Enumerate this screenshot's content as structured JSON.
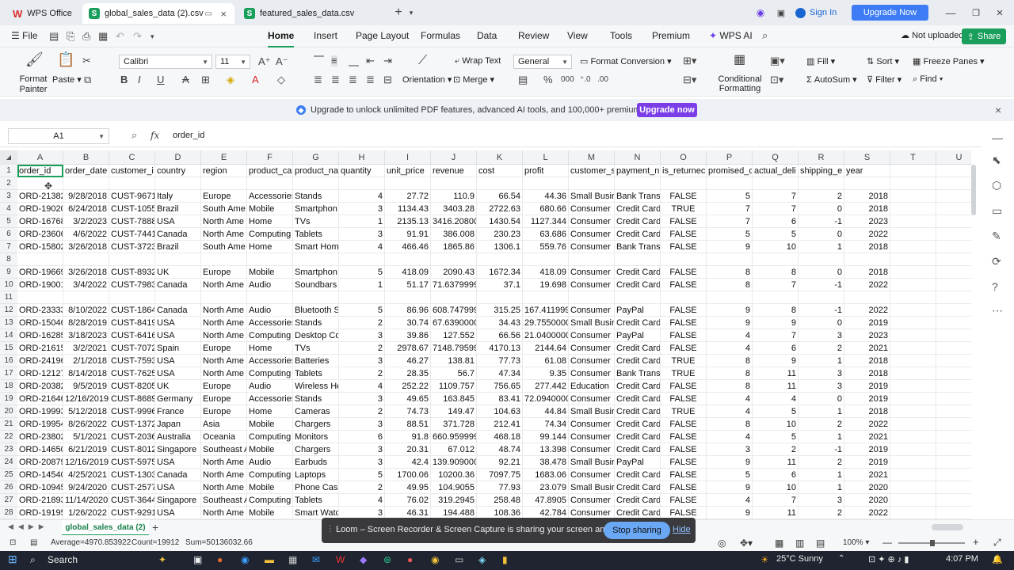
{
  "titlebar": {
    "app_tab": "WPS Office",
    "tabs": [
      {
        "label": "global_sales_data (2).csv"
      },
      {
        "label": "featured_sales_data.csv"
      }
    ],
    "sign_in": "Sign In",
    "upgrade": "Upgrade Now"
  },
  "menubar": {
    "file": "File",
    "items": [
      "Home",
      "Insert",
      "Page Layout",
      "Formulas",
      "Data",
      "Review",
      "View",
      "Tools",
      "Premium",
      "WPS AI"
    ],
    "not_uploaded": "Not uploaded",
    "share": "Share"
  },
  "ribbon": {
    "format_painter": "Format Painter",
    "paste": "Paste",
    "font": "Calibri",
    "font_size": "11",
    "wrap_text": "Wrap Text",
    "orientation": "Orientation",
    "merge": "Merge",
    "number_format": "General",
    "format_conversion": "Format Conversion",
    "conditional_formatting": "Conditional Formatting",
    "fill": "Fill",
    "sort": "Sort",
    "freeze_panes": "Freeze Panes",
    "autosum": "AutoSum",
    "filter": "Filter",
    "find": "Find"
  },
  "promo": {
    "text": "Upgrade to unlock unlimited PDF features, advanced AI tools, and 100,000+ premium templates.",
    "button": "Upgrade now"
  },
  "formula_bar": {
    "name_box": "A1",
    "fx": "fx",
    "formula": "order_id"
  },
  "sheet": {
    "columns": [
      "A",
      "B",
      "C",
      "D",
      "E",
      "F",
      "G",
      "H",
      "I",
      "J",
      "K",
      "L",
      "M",
      "N",
      "O",
      "P",
      "Q",
      "R",
      "S",
      "T",
      "U"
    ],
    "headers": [
      "order_id",
      "order_date",
      "customer_i",
      "country",
      "region",
      "product_ca",
      "product_na",
      "quantity",
      "unit_price",
      "revenue",
      "cost",
      "profit",
      "customer_s",
      "payment_n",
      "is_returnec",
      "promised_c",
      "actual_deli",
      "shipping_e",
      "year"
    ],
    "rows": [
      {
        "n": "1",
        "header": true
      },
      {
        "n": "2",
        "cells": []
      },
      {
        "n": "3",
        "cells": [
          "ORD-21382!",
          "9/28/2018",
          "CUST-96711",
          "Italy",
          "Europe",
          "Accessories",
          "Stands",
          "4",
          "27.72",
          "110.9",
          "66.54",
          "44.36",
          "Small Busir",
          "Bank Transf",
          "FALSE",
          "5",
          "7",
          "2",
          "2018"
        ]
      },
      {
        "n": "4",
        "cells": [
          "ORD-19020:",
          "6/24/2018",
          "CUST-10553",
          "Brazil",
          "South Ame",
          "Mobile",
          "Smartphon",
          "3",
          "1134.43",
          "3403.28",
          "2722.63",
          "680.66",
          "Consumer",
          "Credit Card",
          "TRUE",
          "7",
          "7",
          "0",
          "2018"
        ]
      },
      {
        "n": "5",
        "cells": [
          "ORD-16768(",
          "3/2/2023",
          "CUST-78887",
          "USA",
          "North Ame",
          "Home",
          "TVs",
          "1",
          "2135.13",
          "3416.20800(",
          "1430.54",
          "1127.344",
          "Consumer",
          "Credit Card",
          "FALSE",
          "7",
          "6",
          "-1",
          "2023"
        ]
      },
      {
        "n": "6",
        "cells": [
          "ORD-23606!",
          "4/6/2022",
          "CUST-74416",
          "Canada",
          "North Ame",
          "Computing",
          "Tablets",
          "3",
          "91.91",
          "386.008",
          "230.23",
          "63.686",
          "Consumer",
          "Credit Card",
          "FALSE",
          "5",
          "5",
          "0",
          "2022"
        ]
      },
      {
        "n": "7",
        "cells": [
          "ORD-15802",
          "3/26/2018",
          "CUST-37230",
          "Brazil",
          "South Ame",
          "Home",
          "Smart Hom",
          "4",
          "466.46",
          "1865.86",
          "1306.1",
          "559.76",
          "Consumer",
          "Bank Transf",
          "FALSE",
          "9",
          "10",
          "1",
          "2018"
        ]
      },
      {
        "n": "8",
        "cells": []
      },
      {
        "n": "9",
        "cells": [
          "ORD-19669",
          "3/26/2018",
          "CUST-89326",
          "UK",
          "Europe",
          "Mobile",
          "Smartphon",
          "5",
          "418.09",
          "2090.43",
          "1672.34",
          "418.09",
          "Consumer",
          "Credit Card",
          "FALSE",
          "8",
          "8",
          "0",
          "2018"
        ]
      },
      {
        "n": "10",
        "cells": [
          "ORD-19001!",
          "3/4/2022",
          "CUST-79838",
          "Canada",
          "North Ame",
          "Audio",
          "Soundbars",
          "1",
          "51.17",
          "71.6379999!",
          "37.1",
          "19.698",
          "Consumer",
          "Credit Card",
          "FALSE",
          "8",
          "7",
          "-1",
          "2022"
        ]
      },
      {
        "n": "11",
        "cells": []
      },
      {
        "n": "12",
        "cells": [
          "ORD-23333(",
          "8/10/2022",
          "CUST-18645",
          "Canada",
          "North Ame",
          "Audio",
          "Bluetooth S",
          "5",
          "86.96",
          "608.747999!",
          "315.25",
          "167.411999!",
          "Consumer",
          "PayPal",
          "FALSE",
          "9",
          "8",
          "-1",
          "2022"
        ]
      },
      {
        "n": "13",
        "cells": [
          "ORD-15046:",
          "8/28/2019",
          "CUST-84191",
          "USA",
          "North Ame",
          "Accessories",
          "Stands",
          "2",
          "30.74",
          "67.6390000(",
          "34.43",
          "29.7550000!",
          "Small Busir",
          "Credit Card",
          "FALSE",
          "9",
          "9",
          "0",
          "2019"
        ]
      },
      {
        "n": "14",
        "cells": [
          "ORD-16285",
          "3/18/2023",
          "CUST-64165",
          "USA",
          "North Ame",
          "Computing",
          "Desktop Co",
          "3",
          "39.86",
          "127.552",
          "66.56",
          "21.0400000!",
          "Consumer",
          "PayPal",
          "FALSE",
          "4",
          "7",
          "3",
          "2023"
        ]
      },
      {
        "n": "15",
        "cells": [
          "ORD-21615!",
          "3/2/2021",
          "CUST-70728",
          "Spain",
          "Europe",
          "Home",
          "TVs",
          "2",
          "2978.67",
          "7148.79599!",
          "4170.13",
          "2144.64",
          "Consumer",
          "Credit Card",
          "FALSE",
          "4",
          "6",
          "2",
          "2021"
        ]
      },
      {
        "n": "16",
        "cells": [
          "ORD-24196:",
          "2/1/2018",
          "CUST-75935",
          "USA",
          "North Ame",
          "Accessories",
          "Batteries",
          "3",
          "46.27",
          "138.81",
          "77.73",
          "61.08",
          "Consumer",
          "Credit Card",
          "TRUE",
          "8",
          "9",
          "1",
          "2018"
        ]
      },
      {
        "n": "17",
        "cells": [
          "ORD-12127:",
          "8/14/2018",
          "CUST-76255",
          "USA",
          "North Ame",
          "Computing",
          "Tablets",
          "2",
          "28.35",
          "56.7",
          "47.34",
          "9.35",
          "Consumer",
          "Bank Transf",
          "TRUE",
          "8",
          "11",
          "3",
          "2018"
        ]
      },
      {
        "n": "18",
        "cells": [
          "ORD-20382!",
          "9/5/2019",
          "CUST-82055",
          "UK",
          "Europe",
          "Audio",
          "Wireless He",
          "4",
          "252.22",
          "1109.757",
          "756.65",
          "277.442",
          "Education",
          "Credit Card",
          "FALSE",
          "8",
          "11",
          "3",
          "2019"
        ]
      },
      {
        "n": "19",
        "cells": [
          "ORD-21646!",
          "12/16/2019",
          "CUST-86893",
          "Germany",
          "Europe",
          "Accessories",
          "Stands",
          "3",
          "49.65",
          "163.845",
          "83.41",
          "72.0940000!",
          "Consumer",
          "Credit Card",
          "FALSE",
          "4",
          "4",
          "0",
          "2019"
        ]
      },
      {
        "n": "20",
        "cells": [
          "ORD-19993!",
          "5/12/2018",
          "CUST-99962",
          "France",
          "Europe",
          "Home",
          "Cameras",
          "2",
          "74.73",
          "149.47",
          "104.63",
          "44.84",
          "Small Busir",
          "Credit Card",
          "TRUE",
          "4",
          "5",
          "1",
          "2018"
        ]
      },
      {
        "n": "21",
        "cells": [
          "ORD-19954(",
          "8/26/2022",
          "CUST-13720",
          "Japan",
          "Asia",
          "Mobile",
          "Chargers",
          "3",
          "88.51",
          "371.728",
          "212.41",
          "74.34",
          "Consumer",
          "Credit Card",
          "FALSE",
          "8",
          "10",
          "2",
          "2022"
        ]
      },
      {
        "n": "22",
        "cells": [
          "ORD-23802!",
          "5/1/2021",
          "CUST-20365",
          "Australia",
          "Oceania",
          "Computing",
          "Monitors",
          "6",
          "91.8",
          "660.959999!",
          "468.18",
          "99.144",
          "Consumer",
          "Credit Card",
          "FALSE",
          "4",
          "5",
          "1",
          "2021"
        ]
      },
      {
        "n": "23",
        "cells": [
          "ORD-14650:",
          "6/21/2019",
          "CUST-80126",
          "Singapore",
          "Southeast A",
          "Mobile",
          "Chargers",
          "3",
          "20.31",
          "67.012",
          "48.74",
          "13.398",
          "Consumer",
          "Credit Card",
          "FALSE",
          "3",
          "2",
          "-1",
          "2019"
        ]
      },
      {
        "n": "24",
        "cells": [
          "ORD-20879:",
          "12/16/2019",
          "CUST-59754",
          "USA",
          "North Ame",
          "Audio",
          "Earbuds",
          "3",
          "42.4",
          "139.909000(",
          "92.21",
          "38.478",
          "Small Busir",
          "PayPal",
          "FALSE",
          "9",
          "11",
          "2",
          "2019"
        ]
      },
      {
        "n": "25",
        "cells": [
          "ORD-14540!",
          "4/25/2021",
          "CUST-13033",
          "Canada",
          "North Ame",
          "Computing",
          "Laptops",
          "5",
          "1700.06",
          "10200.36",
          "7097.75",
          "1683.06",
          "Consumer",
          "Credit Card",
          "FALSE",
          "5",
          "6",
          "1",
          "2021"
        ]
      },
      {
        "n": "26",
        "cells": [
          "ORD-10945(",
          "9/24/2020",
          "CUST-25771",
          "USA",
          "North Ame",
          "Mobile",
          "Phone Case",
          "2",
          "49.95",
          "104.9055",
          "77.93",
          "23.079",
          "Small Busir",
          "Credit Card",
          "FALSE",
          "9",
          "10",
          "1",
          "2020"
        ]
      },
      {
        "n": "27",
        "cells": [
          "ORD-21893:",
          "11/14/2020",
          "CUST-36445",
          "Singapore",
          "Southeast A",
          "Computing",
          "Tablets",
          "4",
          "76.02",
          "319.2945",
          "258.48",
          "47.8905",
          "Consumer",
          "Credit Card",
          "FALSE",
          "4",
          "7",
          "3",
          "2020"
        ]
      },
      {
        "n": "28",
        "cells": [
          "ORD-19195!",
          "1/26/2022",
          "CUST-92915",
          "USA",
          "North Ame",
          "Mobile",
          "Smart Watc",
          "3",
          "46.31",
          "194.488",
          "108.36",
          "42.784",
          "Consumer",
          "Credit Card",
          "FALSE",
          "9",
          "11",
          "2",
          "2022"
        ]
      }
    ]
  },
  "sheet_tab": "global_sales_data (2)",
  "status": {
    "average": "Average=4970.853922",
    "count": "Count=19912",
    "sum": "Sum=50136032.66",
    "zoom": "100%"
  },
  "loom": {
    "text": "Loom – Screen Recorder & Screen Capture is sharing your screen and audio.",
    "stop": "Stop sharing",
    "hide": "Hide"
  },
  "taskbar": {
    "search": "Search",
    "weather": "25°C Sunny",
    "time": "4:07 PM"
  }
}
